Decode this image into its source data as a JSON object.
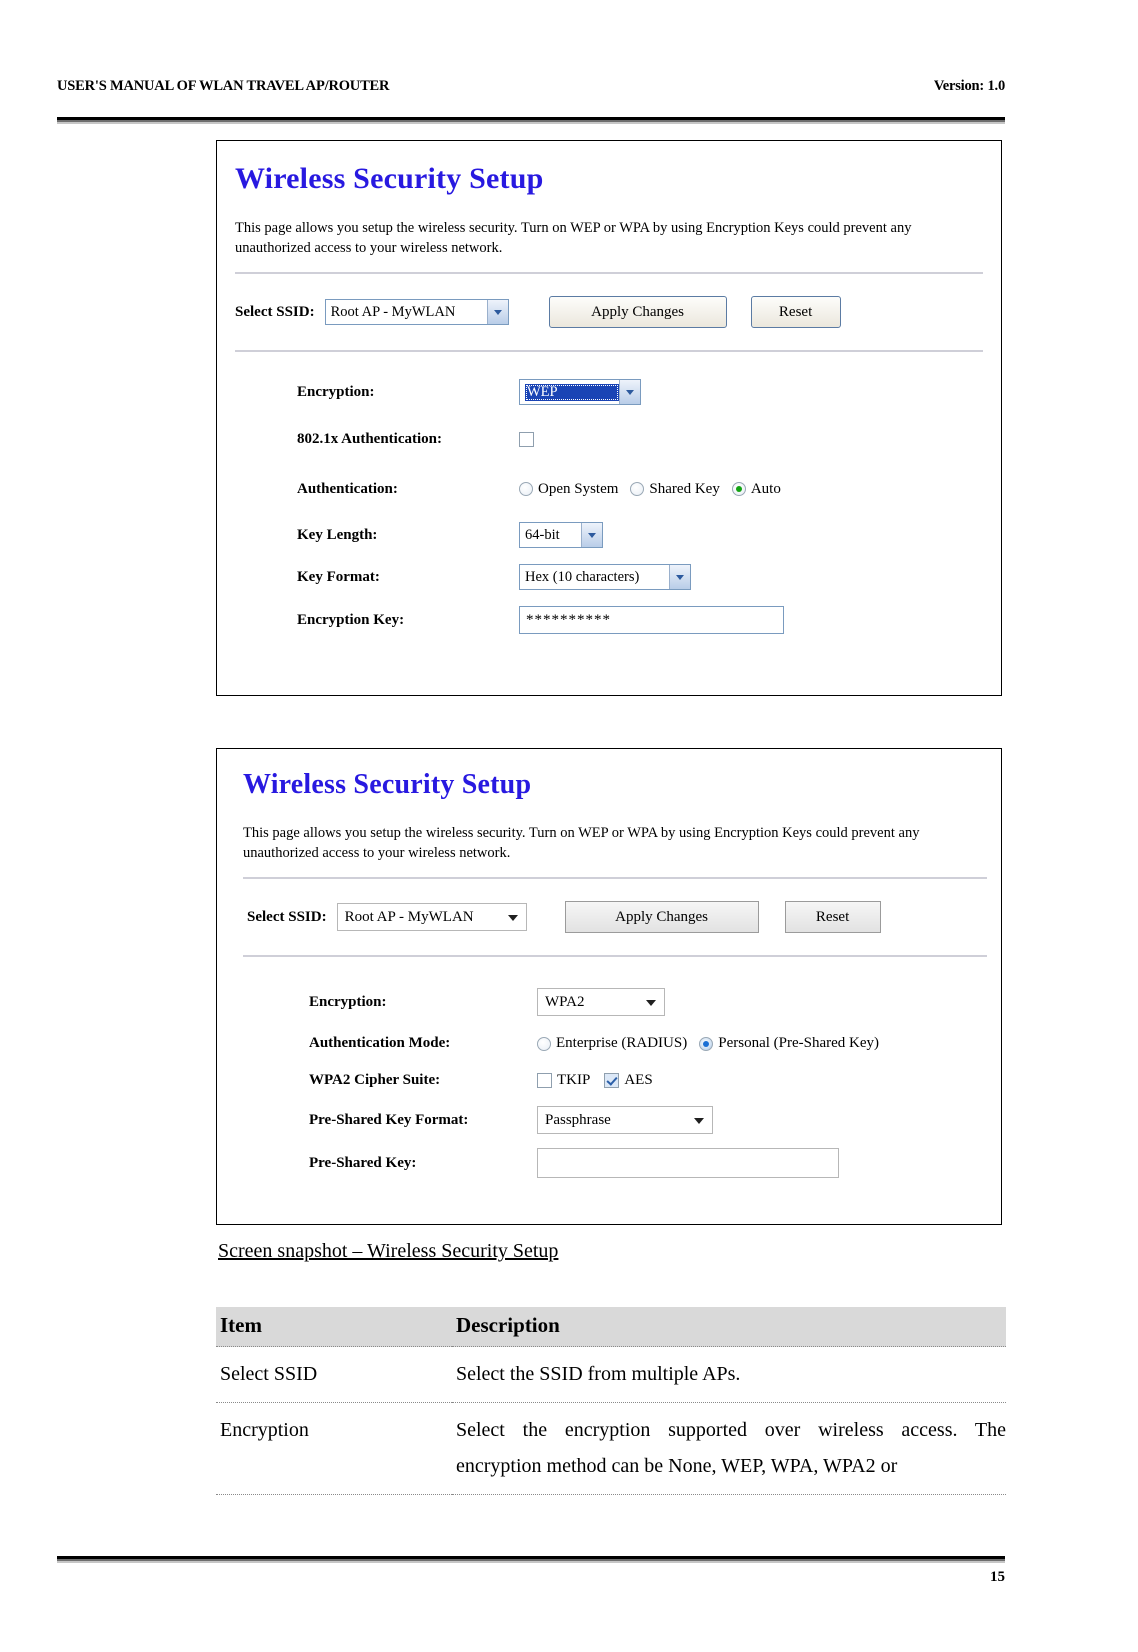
{
  "header": {
    "title": "USER'S MANUAL OF WLAN TRAVEL AP/ROUTER",
    "version": "Version: 1.0"
  },
  "footer": {
    "page_number": "15"
  },
  "screenshot_wep": {
    "title": "Wireless Security Setup",
    "description": "This page allows you setup the wireless security. Turn on WEP or WPA by using Encryption Keys could prevent any unauthorized access to your wireless network.",
    "ssid_label": "Select SSID:",
    "ssid_value": "Root AP - MyWLAN",
    "apply_label": "Apply Changes",
    "reset_label": "Reset",
    "fields": {
      "encryption_label": "Encryption:",
      "encryption_value": "WEP",
      "dot1x_label": "802.1x Authentication:",
      "dot1x_checked": false,
      "authentication_label": "Authentication:",
      "auth_options": [
        {
          "label": "Open System",
          "selected": false
        },
        {
          "label": "Shared Key",
          "selected": false
        },
        {
          "label": "Auto",
          "selected": true
        }
      ],
      "key_length_label": "Key Length:",
      "key_length_value": "64-bit",
      "key_format_label": "Key Format:",
      "key_format_value": "Hex (10 characters)",
      "encryption_key_label": "Encryption Key:",
      "encryption_key_value": "**********"
    }
  },
  "screenshot_wpa2": {
    "title": "Wireless Security Setup",
    "description": "This page allows you setup the wireless security. Turn on WEP or WPA by using Encryption Keys could prevent any unauthorized access to your wireless network.",
    "ssid_label": "Select SSID:",
    "ssid_value": "Root AP - MyWLAN",
    "apply_label": "Apply Changes",
    "reset_label": "Reset",
    "fields": {
      "encryption_label": "Encryption:",
      "encryption_value": "WPA2",
      "auth_mode_label": "Authentication Mode:",
      "auth_mode_options": [
        {
          "label": "Enterprise (RADIUS)",
          "selected": false
        },
        {
          "label": "Personal (Pre-Shared Key)",
          "selected": true
        }
      ],
      "cipher_suite_label": "WPA2 Cipher Suite:",
      "cipher_options": [
        {
          "label": "TKIP",
          "checked": false
        },
        {
          "label": "AES",
          "checked": true
        }
      ],
      "psk_format_label": "Pre-Shared Key Format:",
      "psk_format_value": "Passphrase",
      "psk_label": "Pre-Shared Key:",
      "psk_value": ""
    }
  },
  "caption": "Screen snapshot – Wireless Security Setup",
  "table": {
    "headers": [
      "Item",
      "Description"
    ],
    "rows": [
      {
        "item": "Select SSID",
        "description": "Select the SSID from multiple APs."
      },
      {
        "item": "Encryption",
        "description": "Select the encryption supported over wireless access. The encryption method can be None, WEP, WPA, WPA2 or"
      }
    ]
  },
  "colors": {
    "title_blue": "#2819e0",
    "table_header_gray": "#d9d9d9",
    "radio_green": "#13a313",
    "radio_blue": "#1a6fd4",
    "select_highlight": "#1a44b5"
  }
}
